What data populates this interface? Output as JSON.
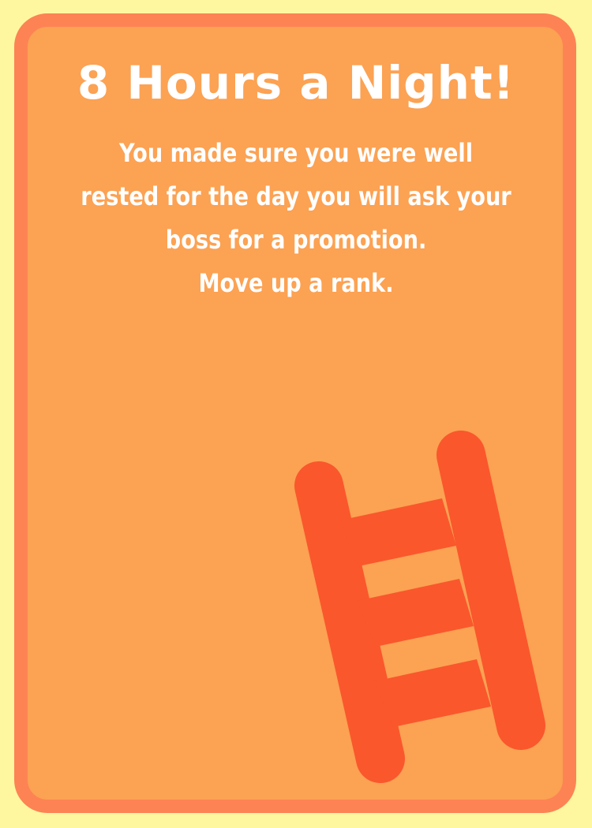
{
  "card": {
    "title": "8 Hours a Night!",
    "description": "You made sure you were well rested for the day you will ask your boss for a promotion.",
    "action": "Move up a rank.",
    "icon": "ladder-icon"
  },
  "colors": {
    "background": "#fff7a0",
    "card_border": "#fd8354",
    "card_fill": "#fca253",
    "ladder": "#fa572c",
    "text": "#ffffff"
  }
}
